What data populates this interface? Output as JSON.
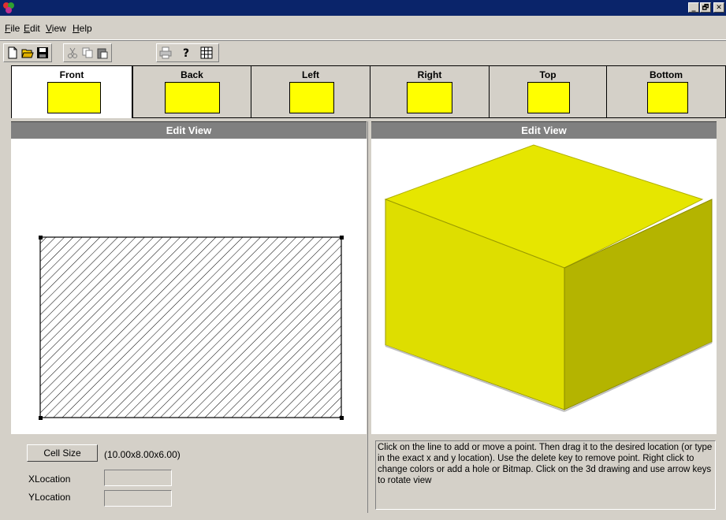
{
  "window": {
    "title": "",
    "controls": {
      "minimize": "_",
      "maximize": "🗗",
      "close": "✕"
    }
  },
  "menu": {
    "items": [
      {
        "accel": "F",
        "rest": "ile"
      },
      {
        "accel": "E",
        "rest": "dit"
      },
      {
        "accel": "V",
        "rest": "iew"
      },
      {
        "accel": "H",
        "rest": "elp"
      }
    ]
  },
  "toolbar": {
    "icons": [
      "new-file-icon",
      "open-folder-icon",
      "save-icon",
      "cut-icon",
      "copy-icon",
      "paste-icon",
      "print-icon",
      "help-icon",
      "grid-icon"
    ]
  },
  "tabs": [
    {
      "label": "Front",
      "active": true
    },
    {
      "label": "Back",
      "active": false
    },
    {
      "label": "Left",
      "active": false
    },
    {
      "label": "Right",
      "active": false
    },
    {
      "label": "Top",
      "active": false
    },
    {
      "label": "Bottom",
      "active": false
    }
  ],
  "colors": {
    "face": "#ffff00",
    "box_top": "#e6e600",
    "box_front": "#dede00",
    "box_side": "#b4b400",
    "title_bar": "#0a246a",
    "header": "#808080"
  },
  "left_pane": {
    "header": "Edit View",
    "cell_size_button": "Cell Size",
    "cell_size_value": "(10.00x8.00x6.00)",
    "x_label": "XLocation",
    "y_label": "YLocation",
    "x_value": "",
    "y_value": ""
  },
  "right_pane": {
    "header": "Edit View",
    "help_text": "Click on the line to add or move a point. Then drag it to the desired location (or type in the exact x and y location). Use the delete key to remove point. Right click to change colors or add a hole or Bitmap. Click on the 3d drawing and use arrow keys to rotate view"
  }
}
